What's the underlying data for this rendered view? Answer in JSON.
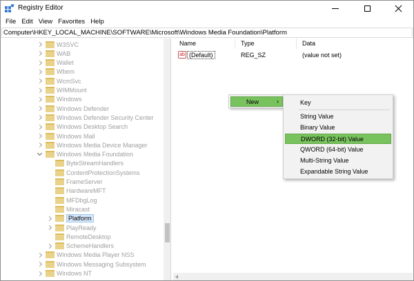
{
  "window": {
    "title": "Registry Editor",
    "icons": {
      "app": "registry-editor-icon",
      "minimize": "minimize-icon",
      "maximize": "maximize-icon",
      "close": "close-icon"
    }
  },
  "menubar": [
    "File",
    "Edit",
    "View",
    "Favorites",
    "Help"
  ],
  "address": "Computer\\HKEY_LOCAL_MACHINE\\SOFTWARE\\Microsoft\\Windows Media Foundation\\Platform",
  "tree": {
    "items": [
      {
        "label": "W3SVC",
        "level": 0,
        "state": "collapsed",
        "faded": true
      },
      {
        "label": "WAB",
        "level": 0,
        "state": "collapsed",
        "faded": true
      },
      {
        "label": "Wallet",
        "level": 0,
        "state": "collapsed",
        "faded": true
      },
      {
        "label": "Wbem",
        "level": 0,
        "state": "collapsed",
        "faded": true
      },
      {
        "label": "WcmSvc",
        "level": 0,
        "state": "collapsed",
        "faded": true
      },
      {
        "label": "WIMMount",
        "level": 0,
        "state": "collapsed",
        "faded": true
      },
      {
        "label": "Windows",
        "level": 0,
        "state": "collapsed",
        "faded": true
      },
      {
        "label": "Windows Defender",
        "level": 0,
        "state": "collapsed",
        "faded": true
      },
      {
        "label": "Windows Defender Security Center",
        "level": 0,
        "state": "collapsed",
        "faded": true
      },
      {
        "label": "Windows Desktop Search",
        "level": 0,
        "state": "collapsed",
        "faded": true
      },
      {
        "label": "Windows Mail",
        "level": 0,
        "state": "collapsed",
        "faded": true
      },
      {
        "label": "Windows Media Device Manager",
        "level": 0,
        "state": "collapsed",
        "faded": true
      },
      {
        "label": "Windows Media Foundation",
        "level": 0,
        "state": "expanded",
        "faded": true
      },
      {
        "label": "ByteStreamHandlers",
        "level": 1,
        "state": "leaf",
        "faded": true
      },
      {
        "label": "ContentProtectionSystems",
        "level": 1,
        "state": "leaf",
        "faded": true
      },
      {
        "label": "FrameServer",
        "level": 1,
        "state": "leaf",
        "faded": true
      },
      {
        "label": "HardwareMFT",
        "level": 1,
        "state": "leaf",
        "faded": true
      },
      {
        "label": "MFDbgLog",
        "level": 1,
        "state": "leaf",
        "faded": true
      },
      {
        "label": "Miracast",
        "level": 1,
        "state": "leaf",
        "faded": true
      },
      {
        "label": "Platform",
        "level": 1,
        "state": "collapsed",
        "faded": false,
        "selected": true
      },
      {
        "label": "PlayReady",
        "level": 1,
        "state": "collapsed",
        "faded": true
      },
      {
        "label": "RemoteDesktop",
        "level": 1,
        "state": "leaf",
        "faded": true
      },
      {
        "label": "SchemeHandlers",
        "level": 1,
        "state": "collapsed",
        "faded": true
      },
      {
        "label": "Windows Media Player NSS",
        "level": 0,
        "state": "collapsed",
        "faded": true
      },
      {
        "label": "Windows Messaging Subsystem",
        "level": 0,
        "state": "collapsed",
        "faded": true
      },
      {
        "label": "Windows NT",
        "level": 0,
        "state": "collapsed",
        "faded": true
      }
    ]
  },
  "values_pane": {
    "columns": {
      "name": "Name",
      "type": "Type",
      "data": "Data"
    },
    "rows": [
      {
        "icon": "string-value-icon",
        "icon_text": "ab",
        "name": "(Default)",
        "type": "REG_SZ",
        "data": "(value not set)"
      }
    ]
  },
  "context_menu": {
    "new_label": "New",
    "submenu": [
      {
        "label": "Key",
        "highlighted": false
      },
      {
        "label": "String Value",
        "highlighted": false
      },
      {
        "label": "Binary Value",
        "highlighted": false
      },
      {
        "label": "DWORD (32-bit) Value",
        "highlighted": true
      },
      {
        "label": "QWORD (64-bit) Value",
        "highlighted": false
      },
      {
        "label": "Multi-String Value",
        "highlighted": false
      },
      {
        "label": "Expandable String Value",
        "highlighted": false
      }
    ]
  },
  "colors": {
    "menu_highlight": "#79c35e",
    "folder": "#e9d28a",
    "faded_text": "#9e9e9e"
  }
}
